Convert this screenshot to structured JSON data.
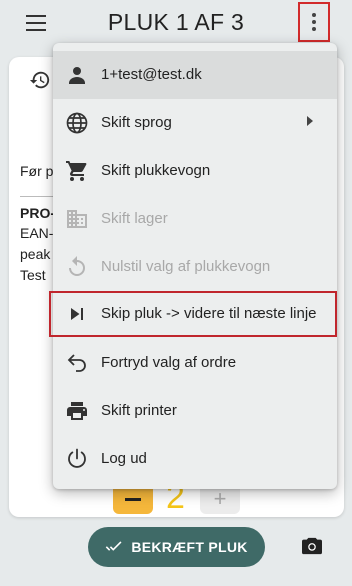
{
  "header": {
    "title": "PLUK 1 AF 3"
  },
  "background": {
    "line_before": "Før p",
    "product_code": "PRO-",
    "ean": "EAN-",
    "location": "peak",
    "note": "Test",
    "quantity": "2",
    "plus_label": "+",
    "confirm_label": "BEKRÆFT PLUK"
  },
  "menu": {
    "items": [
      {
        "label": "1+test@test.dk",
        "icon": "person-icon",
        "state": "selected"
      },
      {
        "label": "Skift sprog",
        "icon": "globe-icon",
        "state": "normal",
        "submenu": true
      },
      {
        "label": "Skift plukkevogn",
        "icon": "cart-icon",
        "state": "normal"
      },
      {
        "label": "Skift lager",
        "icon": "warehouse-icon",
        "state": "disabled"
      },
      {
        "label": "Nulstil valg af plukkevogn",
        "icon": "reset-icon",
        "state": "disabled"
      },
      {
        "label": "Skip pluk -> videre til næste linje",
        "icon": "skip-next-icon",
        "state": "highlighted"
      },
      {
        "label": "Fortryd valg af ordre",
        "icon": "undo-icon",
        "state": "normal"
      },
      {
        "label": "Skift printer",
        "icon": "printer-icon",
        "state": "normal"
      },
      {
        "label": "Log ud",
        "icon": "power-icon",
        "state": "normal"
      }
    ]
  },
  "colors": {
    "accent": "#3f6a67",
    "highlight": "#c0262d",
    "quantity": "#f5c518",
    "minus_button": "#f5b73b"
  }
}
